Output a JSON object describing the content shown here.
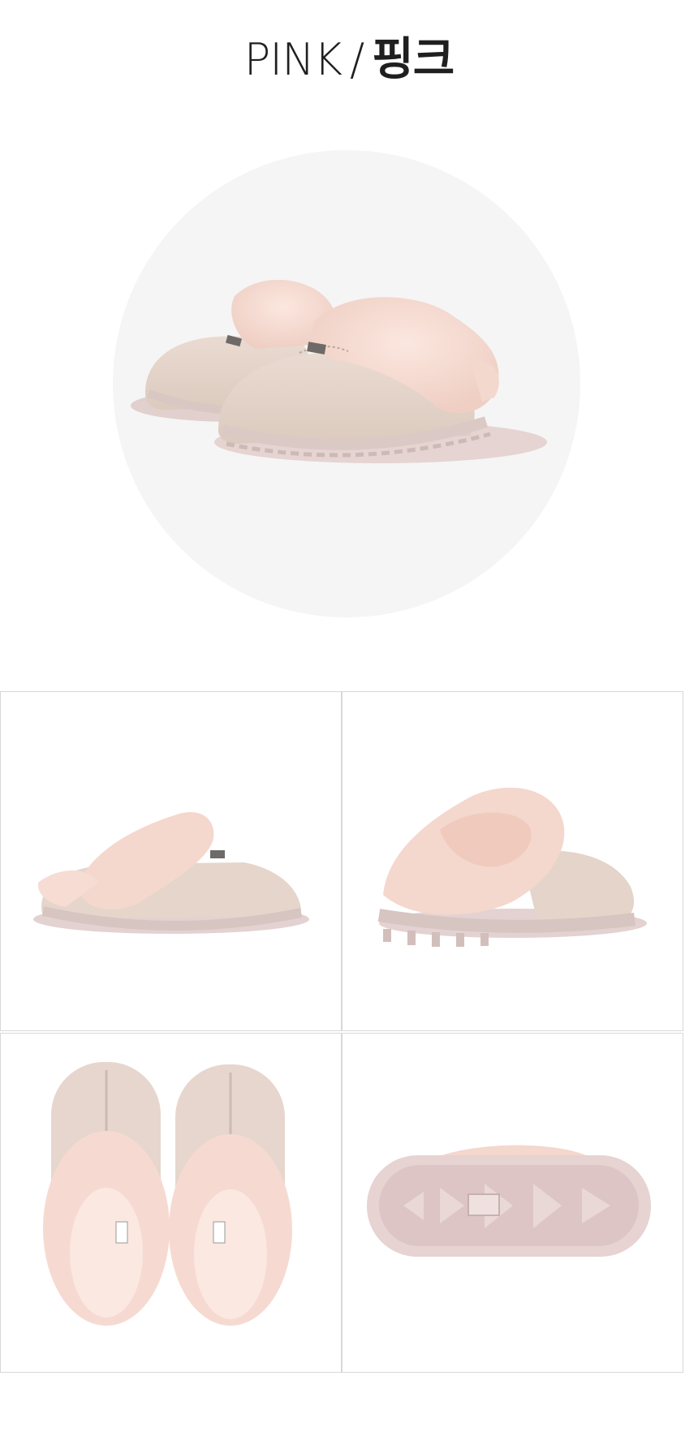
{
  "header": {
    "color_en": "PINK",
    "separator": "/",
    "color_ko": "핑크"
  },
  "palette": {
    "suede": "#e6d6cc",
    "fur": "#f6dcd3",
    "sole": "#e9d8d6",
    "circle_bg": "#f5f5f5",
    "border": "#d8d8d8"
  },
  "hero": {
    "icon": "slipper-pair-photo"
  },
  "gallery": {
    "items": [
      {
        "icon": "slipper-side-view-photo"
      },
      {
        "icon": "slipper-back-view-photo"
      },
      {
        "icon": "slipper-top-view-photo"
      },
      {
        "icon": "slipper-sole-view-photo"
      }
    ]
  }
}
